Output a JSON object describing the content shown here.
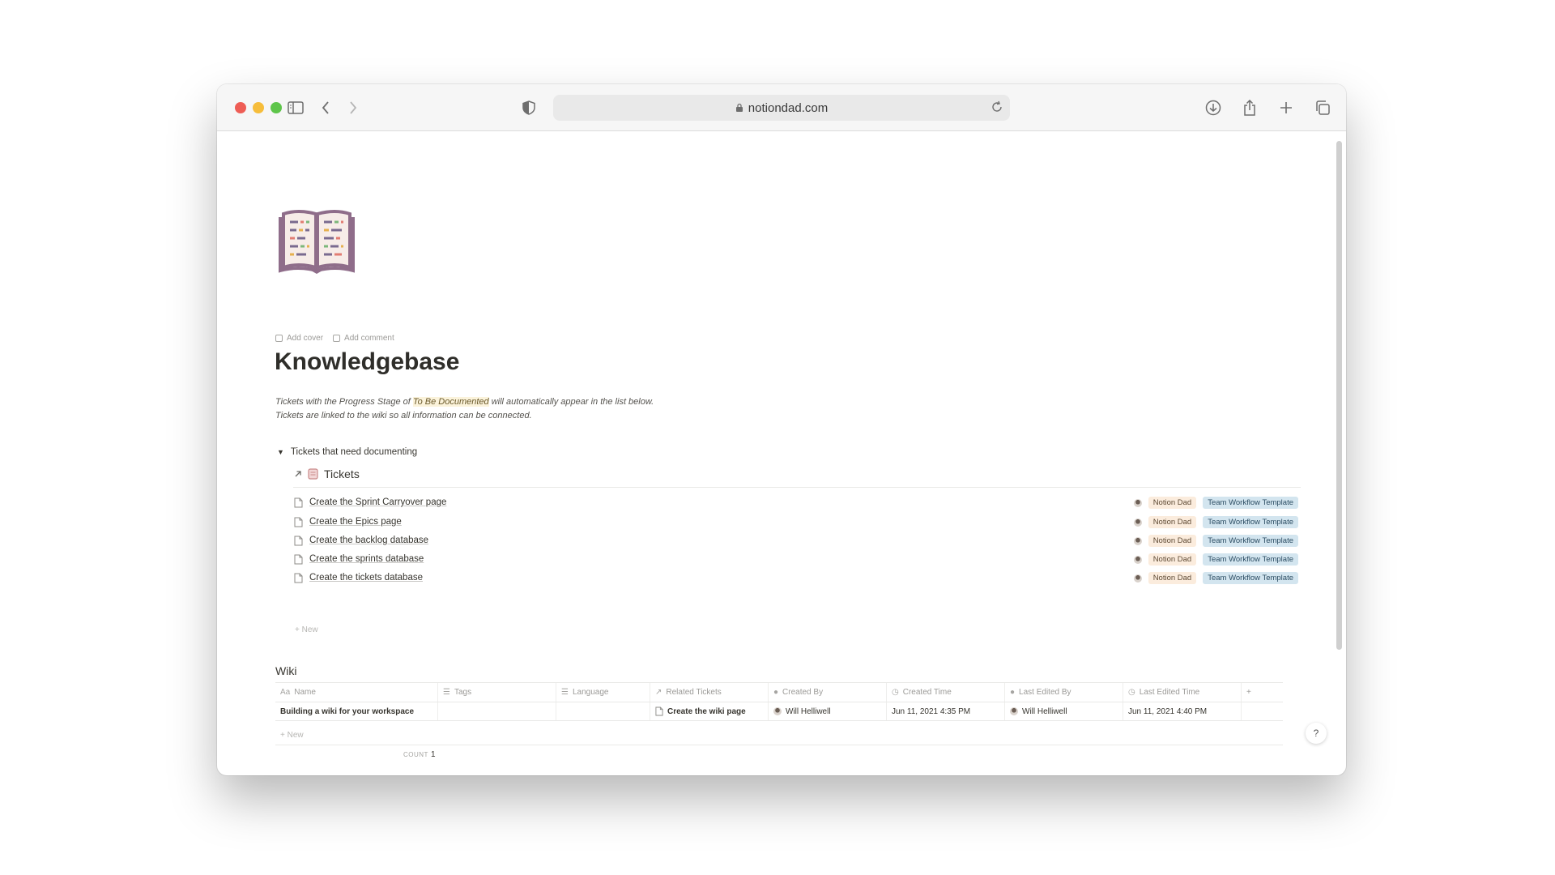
{
  "browser": {
    "url": "notiondad.com"
  },
  "page": {
    "meta": {
      "add_cover": "Add cover",
      "add_comment": "Add comment"
    },
    "title": "Knowledgebase",
    "description": {
      "line1_pre": "Tickets with the Progress Stage of ",
      "line1_highlight": "To Be Documented",
      "line1_post": " will automatically appear in the list below.",
      "line2": "Tickets are linked to the wiki so all information can be connected."
    },
    "toggle_label": "Tickets that need documenting",
    "tickets_db": {
      "title": "Tickets",
      "rows": [
        {
          "name": "Create the Sprint Carryover page",
          "person": "Notion Dad",
          "template": "Team Workflow Template"
        },
        {
          "name": "Create the Epics page",
          "person": "Notion Dad",
          "template": "Team Workflow Template"
        },
        {
          "name": "Create the backlog database",
          "person": "Notion Dad",
          "template": "Team Workflow Template"
        },
        {
          "name": "Create the sprints database",
          "person": "Notion Dad",
          "template": "Team Workflow Template"
        },
        {
          "name": "Create the tickets database",
          "person": "Notion Dad",
          "template": "Team Workflow Template"
        }
      ],
      "new_label": "New"
    },
    "wiki": {
      "title": "Wiki",
      "columns": [
        "Name",
        "Tags",
        "Language",
        "Related Tickets",
        "Created By",
        "Created Time",
        "Last Edited By",
        "Last Edited Time"
      ],
      "add_column": "+",
      "rows": [
        {
          "name": "Building a wiki for your workspace",
          "tags": "",
          "language": "",
          "related": "Create the wiki page",
          "created_by": "Will Helliwell",
          "created_time": "Jun 11, 2021 4:35 PM",
          "last_edited_by": "Will Helliwell",
          "last_edited_time": "Jun 11, 2021 4:40 PM"
        }
      ],
      "new_label": "New",
      "count_label": "COUNT",
      "count_value": "1"
    },
    "help": "?"
  }
}
